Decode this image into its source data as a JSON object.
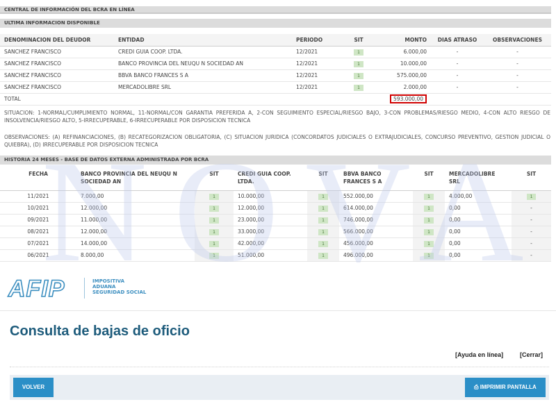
{
  "header": {
    "title": "CENTRAL DE INFORMACIÓN DEL BCRA EN LÍNEA",
    "subtitle": "ULTIMA INFORMACION DISPONIBLE"
  },
  "debts": {
    "columns": [
      "DENOMINACION DEL DEUDOR",
      "ENTIDAD",
      "PERIODO",
      "SIT",
      "MONTO",
      "DIAS ATRASO",
      "OBSERVACIONES"
    ],
    "rows": [
      {
        "debtor": "SANCHEZ FRANCISCO",
        "entity": "CREDI GUIA COOP. LTDA.",
        "period": "12/2021",
        "sit": "1",
        "amount": "6.000,00",
        "days": "-",
        "obs": "-"
      },
      {
        "debtor": "SANCHEZ FRANCISCO",
        "entity": "BANCO PROVINCIA DEL NEUQU N SOCIEDAD AN",
        "period": "12/2021",
        "sit": "1",
        "amount": "10.000,00",
        "days": "-",
        "obs": "-"
      },
      {
        "debtor": "SANCHEZ FRANCISCO",
        "entity": "BBVA BANCO FRANCES S A",
        "period": "12/2021",
        "sit": "1",
        "amount": "575.000,00",
        "days": "-",
        "obs": "-"
      },
      {
        "debtor": "SANCHEZ FRANCISCO",
        "entity": "MERCADOLIBRE SRL",
        "period": "12/2021",
        "sit": "1",
        "amount": "2.000,00",
        "days": "-",
        "obs": "-"
      }
    ],
    "total_label": "TOTAL",
    "total_amount": "593.000,00"
  },
  "notes": {
    "situacion": "SITUACION: 1-NORMAL/CUMPLIMIENTO NORMAL, 11-NORMAL/CON GARANTIA PREFERIDA A, 2-CON SEGUIMIENTO ESPECIAL/RIESGO BAJO, 3-CON PROBLEMAS/RIESGO MEDIO, 4-CON ALTO RIESGO DE INSOLVENCIA/RIESGO ALTO, 5-IRRECUPERABLE, 6-IRRECUPERABLE POR DISPOSICION TECNICA",
    "observaciones": "OBSERVACIONES: (A) REFINANCIACIONES, (B) RECATEGORIZACION OBLIGATORIA, (C) SITUACION JURIDICA (CONCORDATOS JUDICIALES O EXTRAJUDICIALES, CONCURSO PREVENTIVO, GESTION JUDICIAL O QUIEBRA), (D) IRRECUPERABLE POR DISPOSICION TECNICA"
  },
  "history": {
    "title": "HISTORIA 24 MESES - BASE DE DATOS EXTERNA ADMINISTRADA POR BCRA",
    "columns": [
      "FECHA",
      "BANCO PROVINCIA DEL NEUQU N SOCIEDAD AN",
      "SIT",
      "CREDI GUIA COOP. LTDA.",
      "SIT",
      "BBVA BANCO FRANCES S A",
      "SIT",
      "MERCADOLIBRE SRL",
      "SIT"
    ],
    "rows": [
      {
        "date": "11/2021",
        "a": "7.000,00",
        "as": "1",
        "b": "10.000,00",
        "bs": "1",
        "c": "552.000,00",
        "cs": "1",
        "d": "4.000,00",
        "ds": "1"
      },
      {
        "date": "10/2021",
        "a": "12.000,00",
        "as": "1",
        "b": "12.000,00",
        "bs": "1",
        "c": "614.000,00",
        "cs": "1",
        "d": "0,00",
        "ds": "-"
      },
      {
        "date": "09/2021",
        "a": "11.000,00",
        "as": "1",
        "b": "23.000,00",
        "bs": "1",
        "c": "746.000,00",
        "cs": "1",
        "d": "0,00",
        "ds": "-"
      },
      {
        "date": "08/2021",
        "a": "12.000,00",
        "as": "1",
        "b": "33.000,00",
        "bs": "1",
        "c": "566.000,00",
        "cs": "1",
        "d": "0,00",
        "ds": "-"
      },
      {
        "date": "07/2021",
        "a": "14.000,00",
        "as": "1",
        "b": "42.000,00",
        "bs": "1",
        "c": "456.000,00",
        "cs": "1",
        "d": "0,00",
        "ds": "-"
      },
      {
        "date": "06/2021",
        "a": "8.000,00",
        "as": "1",
        "b": "51.000,00",
        "bs": "1",
        "c": "496.000,00",
        "cs": "1",
        "d": "0,00",
        "ds": "-"
      }
    ]
  },
  "watermark": "NOVA",
  "afip": {
    "logo": "AFIP",
    "lines": [
      "IMPOSITIVA",
      "ADUANA",
      "SEGURIDAD SOCIAL"
    ],
    "color": "#3d8fc0"
  },
  "page": {
    "title": "Consulta de bajas de oficio",
    "help_link": "[Ayuda en línea]",
    "close_link": "[Cerrar]"
  },
  "footer": {
    "back_label": "VOLVER",
    "print_label": "IMPRIMIR PANTALLA",
    "button_color": "#2b8fc7"
  }
}
